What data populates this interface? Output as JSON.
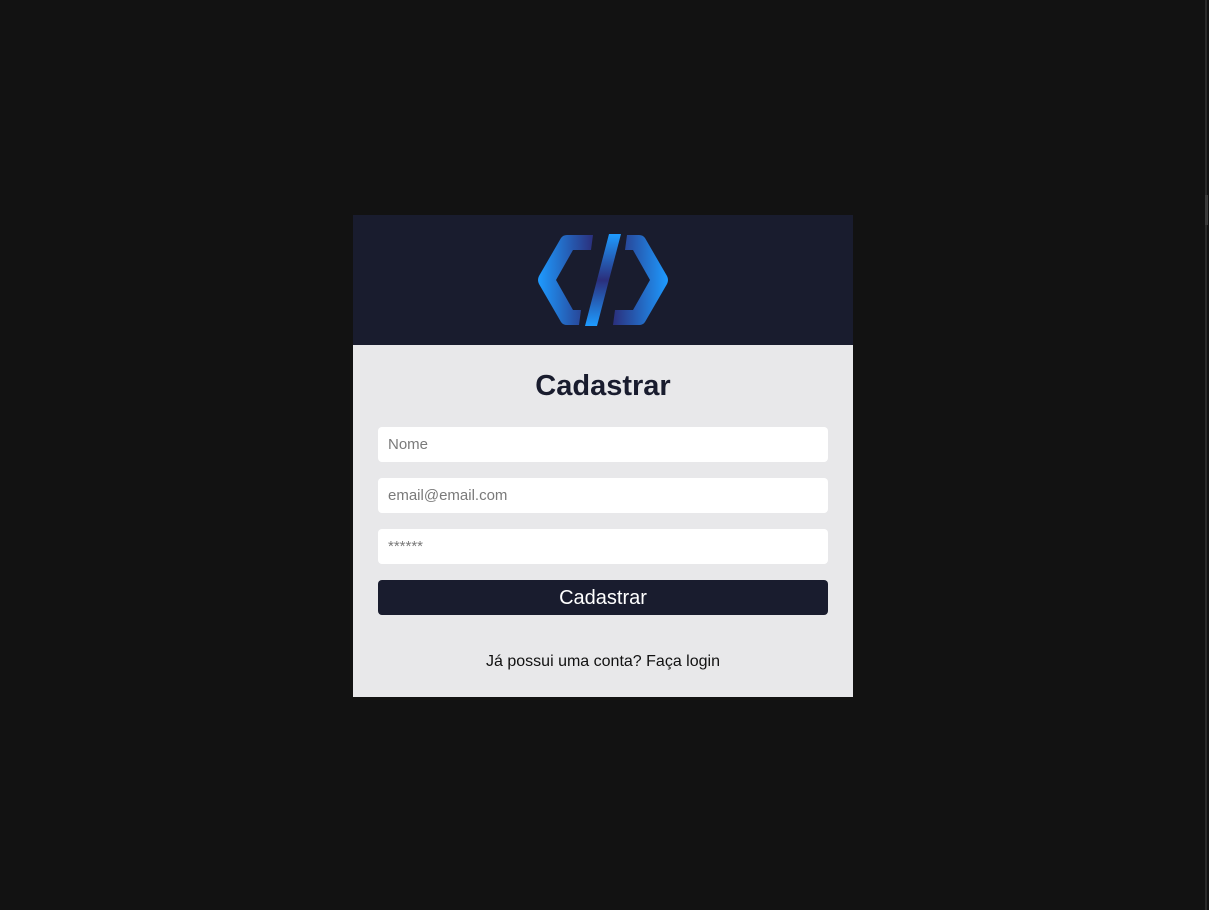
{
  "logo": {
    "icon": "code-brackets-logo-icon",
    "colors": [
      "#1e8fff",
      "#2a2f7a"
    ]
  },
  "form": {
    "title": "Cadastrar",
    "name_placeholder": "Nome",
    "email_placeholder": "email@email.com",
    "password_placeholder": "******",
    "submit_label": "Cadastrar"
  },
  "footer": {
    "question": "Já possui uma conta?",
    "login_link": "Faça login"
  },
  "colors": {
    "page_background": "#121212",
    "header_background": "#191c2e",
    "card_background": "#e8e8ea",
    "button_background": "#191c2e"
  }
}
